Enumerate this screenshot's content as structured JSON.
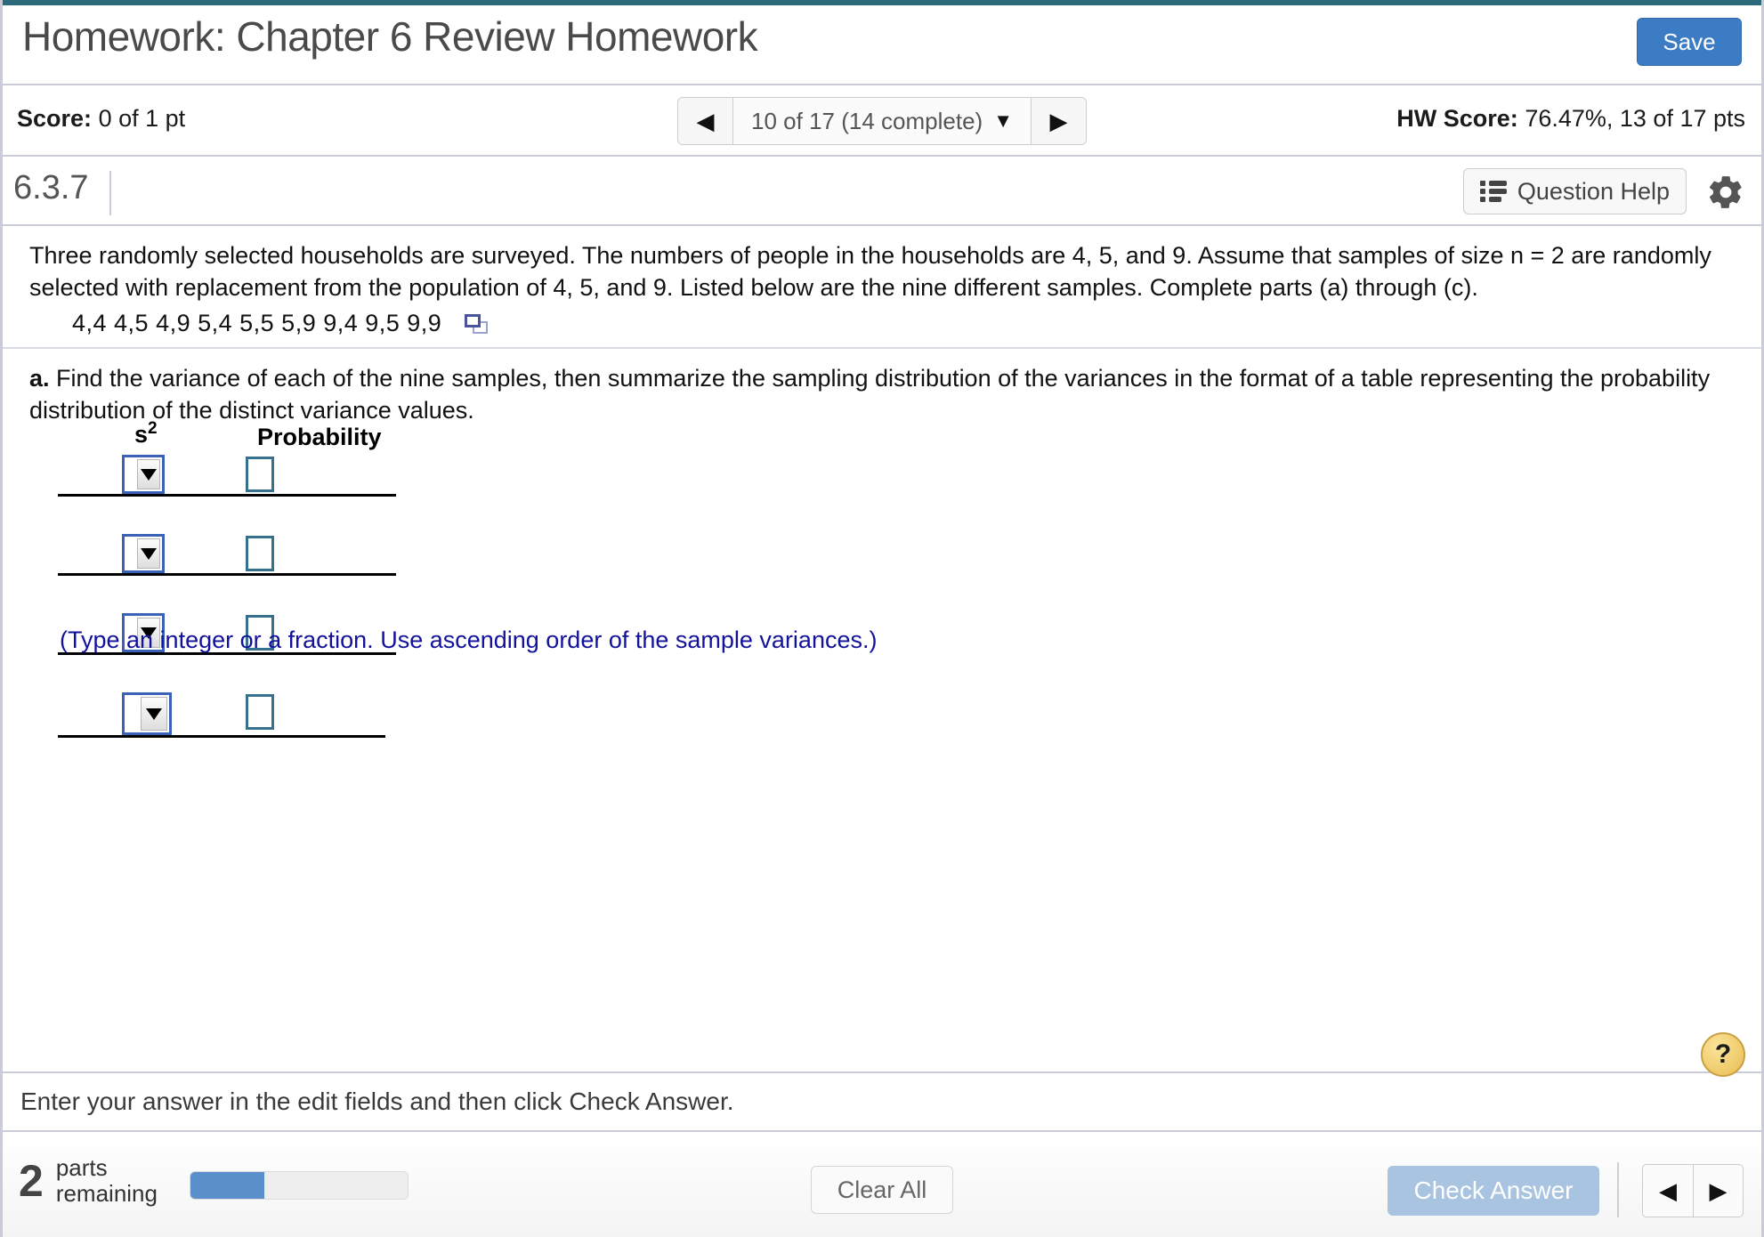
{
  "header": {
    "title": "Homework: Chapter 6 Review Homework",
    "save_label": "Save"
  },
  "scorebar": {
    "score_label": "Score:",
    "score_value": "0 of 1 pt",
    "nav_prev_icon": "◀",
    "nav_next_icon": "▶",
    "nav_label": "10 of 17 (14 complete)",
    "nav_caret": "▼",
    "hw_score_label": "HW Score:",
    "hw_score_value": "76.47%, 13 of 17 pts"
  },
  "question_bar": {
    "question_id": "6.3.7",
    "question_help_label": "Question Help"
  },
  "question": {
    "prompt": "Three randomly selected households are surveyed. The numbers of people in the households are 4, 5, and 9. Assume that samples of size n = 2 are randomly selected with replacement from the population of 4, 5, and 9. Listed below are the nine different samples. Complete parts (a) through (c).",
    "samples": "4,4   4,5   4,9   5,4   5,5   5,9   9,4   9,5   9,9",
    "part_a_bold": "a.",
    "part_a_text": " Find the variance of each of the nine samples, then summarize the sampling distribution of the variances in the format of a table representing the probability distribution of the distinct variance values."
  },
  "answer_table": {
    "col_s2_base": "s",
    "col_s2_sup": "2",
    "col_probability": "Probability",
    "rows": [
      {
        "s2_value": "",
        "probability_value": ""
      },
      {
        "s2_value": "",
        "probability_value": ""
      },
      {
        "s2_value": "",
        "probability_value": ""
      },
      {
        "s2_value": "",
        "probability_value": ""
      }
    ],
    "hint": "(Type an integer or a fraction. Use ascending order of the sample variances.)"
  },
  "footer": {
    "instruction": "Enter your answer in the edit fields and then click Check Answer.",
    "help_glyph": "?",
    "parts_number": "2",
    "parts_line1": "parts",
    "parts_line2": "remaining",
    "progress_percent": 34,
    "clear_all_label": "Clear All",
    "check_answer_label": "Check Answer",
    "prev_icon": "◀",
    "next_icon": "▶"
  },
  "colors": {
    "top_strip": "#2e6b7a",
    "save_blue": "#3b7cc4",
    "dropdown_border": "#3b62b6",
    "input_border": "#35718e",
    "hint_blue": "#12129c",
    "check_answer": "#a8c4e0",
    "progress_fill": "#5b8fc9",
    "help_circle": "#e8bd52"
  }
}
